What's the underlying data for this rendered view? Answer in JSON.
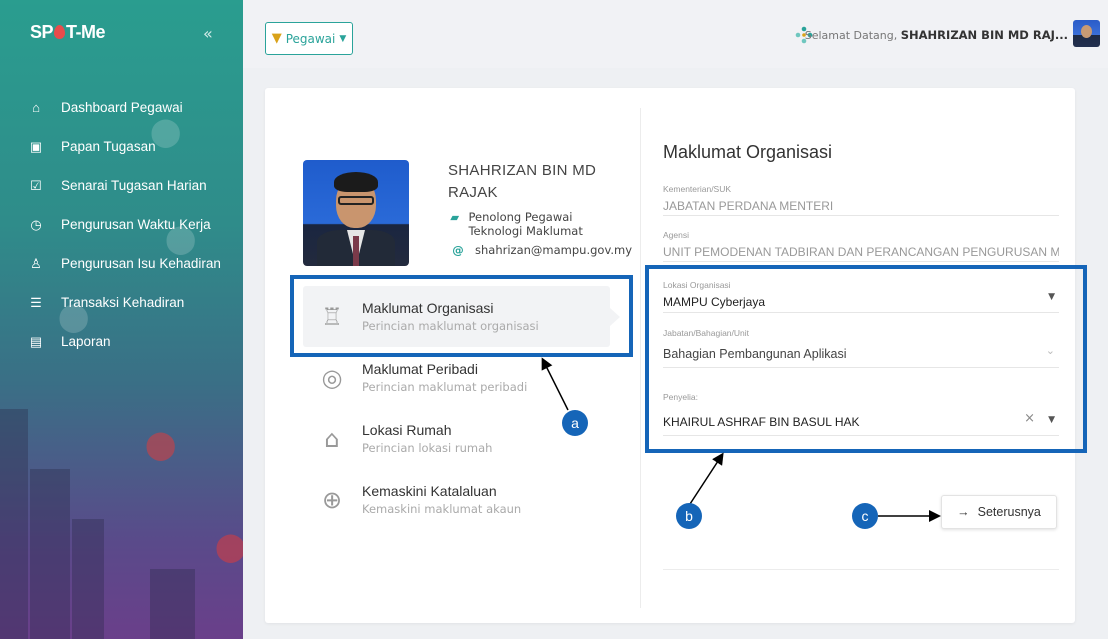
{
  "sidebar": {
    "brand": [
      "SP",
      "T-Me"
    ],
    "items": [
      {
        "label": "Dashboard Pegawai",
        "icon": "home-icon"
      },
      {
        "label": "Papan Tugasan",
        "icon": "board-icon"
      },
      {
        "label": "Senarai Tugasan Harian",
        "icon": "checklist-icon"
      },
      {
        "label": "Pengurusan Waktu Kerja",
        "icon": "clock-icon"
      },
      {
        "label": "Pengurusan Isu Kehadiran",
        "icon": "person-icon"
      },
      {
        "label": "Transaksi Kehadiran",
        "icon": "list-icon"
      },
      {
        "label": "Laporan",
        "icon": "report-icon"
      }
    ]
  },
  "topbar": {
    "role": "Pegawai",
    "welcome": "Selamat Datang,",
    "user": "SHAHRIZAN BIN MD RAJ..."
  },
  "profile": {
    "name": "SHAHRIZAN BIN MD RAJAK",
    "position": "Penolong Pegawai Teknologi Maklumat",
    "email": "shahrizan@mampu.gov.my"
  },
  "menu": [
    {
      "title": "Maklumat Organisasi",
      "subtitle": "Perincian maklumat organisasi",
      "icon": "org-chart-icon"
    },
    {
      "title": "Maklumat Peribadi",
      "subtitle": "Perincian maklumat peribadi",
      "icon": "user-icon"
    },
    {
      "title": "Lokasi Rumah",
      "subtitle": "Perincian lokasi rumah",
      "icon": "house-icon"
    },
    {
      "title": "Kemaskini Katalaluan",
      "subtitle": "Kemaskini maklumat akaun",
      "icon": "globe-lock-icon"
    }
  ],
  "form": {
    "title": "Maklumat Organisasi",
    "fields": {
      "ministry": {
        "label": "Kementerian/SUK",
        "value": "JABATAN PERDANA MENTERI"
      },
      "agency": {
        "label": "Agensi",
        "value": "UNIT PEMODENAN TADBIRAN DAN PERANCANGAN PENGURUSAN MALAYSI"
      },
      "location": {
        "label": "Lokasi Organisasi",
        "value": "MAMPU Cyberjaya"
      },
      "department": {
        "label": "Jabatan/Bahagian/Unit",
        "value": "Bahagian Pembangunan Aplikasi"
      },
      "supervisor": {
        "label": "Penyelia:",
        "value": "KHAIRUL ASHRAF BIN BASUL HAK"
      }
    },
    "next_label": "Seterusnya"
  },
  "annotations": {
    "a": "a",
    "b": "b",
    "c": "c",
    "color": "#1565b8"
  }
}
